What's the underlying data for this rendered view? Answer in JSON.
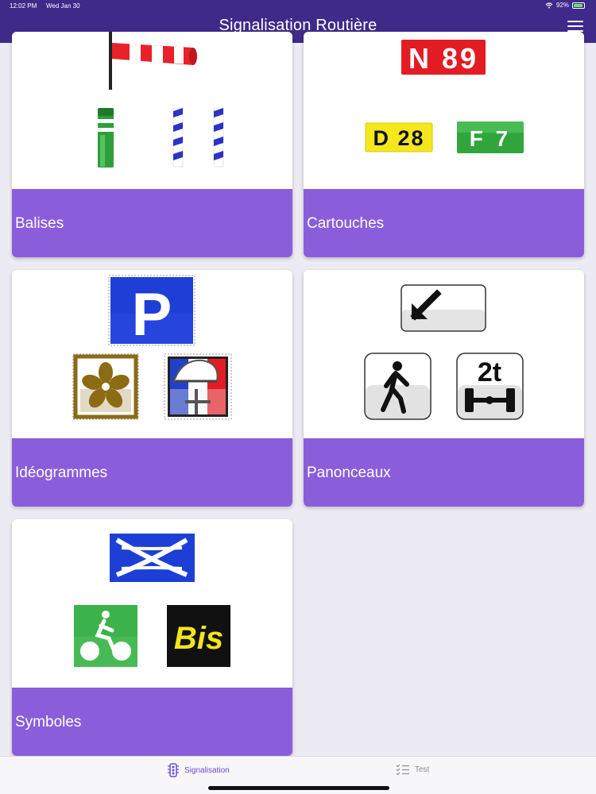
{
  "status": {
    "time": "12:02 PM",
    "date": "Wed Jan 30",
    "battery": "92%"
  },
  "header": {
    "title": "Signalisation Routière"
  },
  "cards": {
    "balises": {
      "label": "Balises"
    },
    "cartouches": {
      "label": "Cartouches",
      "plates": {
        "n": "N 89",
        "d": "D 28",
        "f": "F 7"
      }
    },
    "ideogrammes": {
      "label": "Idéogrammes",
      "parking": "P"
    },
    "panonceaux": {
      "label": "Panonceaux",
      "weight": "2t"
    },
    "symboles": {
      "label": "Symboles",
      "bis": "Bis"
    }
  },
  "tabbar": {
    "tabs": [
      {
        "label": "Signalisation",
        "active": true
      },
      {
        "label": "Test",
        "active": false
      }
    ]
  },
  "colors": {
    "header_bg": "#3F2A8A",
    "card_label_bg": "#8A5DDB",
    "active_tab": "#6A4BD8",
    "inactive_tab": "#8E8E93"
  }
}
